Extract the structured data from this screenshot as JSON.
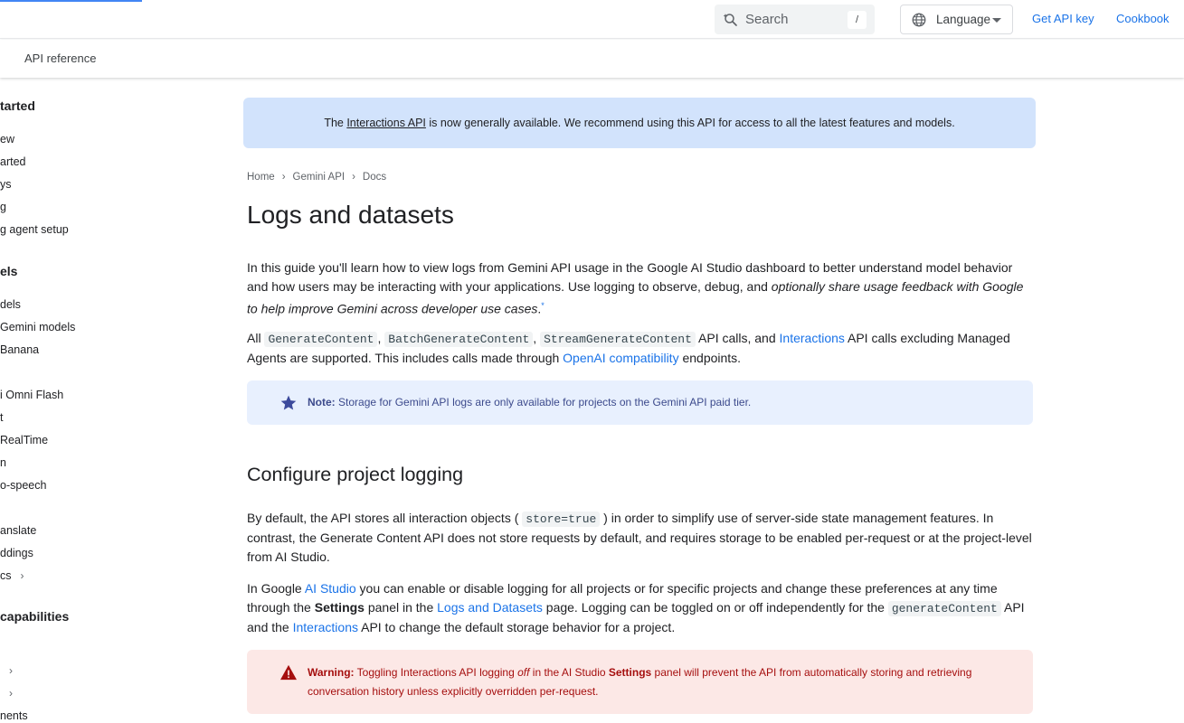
{
  "topbar": {
    "search_placeholder": "Search",
    "search_shortcut": "/",
    "language_label": "Language",
    "get_api_key": "Get API key",
    "cookbook": "Cookbook"
  },
  "subbar": {
    "api_reference": "API reference"
  },
  "sidebar": {
    "items": [
      {
        "label": "tarted",
        "heading": true
      },
      {
        "label": "ew"
      },
      {
        "label": "arted"
      },
      {
        "label": "ys"
      },
      {
        "label": "g"
      },
      {
        "label": "g agent setup"
      },
      {
        "label": "els",
        "heading": true
      },
      {
        "label": "dels"
      },
      {
        "label": " Gemini models"
      },
      {
        "label": "Banana"
      },
      {
        "label": "i Omni Flash"
      },
      {
        "label": "t"
      },
      {
        "label": "RealTime"
      },
      {
        "label": "n"
      },
      {
        "label": "o-speech"
      },
      {
        "label": "anslate"
      },
      {
        "label": "ddings"
      },
      {
        "label": "cs",
        "chevron": true
      },
      {
        "label": "capabilities",
        "heading": true
      },
      {
        "label": "",
        "chevron": true
      },
      {
        "label": "",
        "chevron": true
      },
      {
        "label": "nents"
      }
    ]
  },
  "banner": {
    "pre": "The ",
    "link": "Interactions API",
    "post": " is now generally available. We recommend using this API for access to all the latest features and models."
  },
  "breadcrumb": [
    "Home",
    "Gemini API",
    "Docs"
  ],
  "page": {
    "title": "Logs and datasets",
    "intro": {
      "text1": "In this guide you'll learn how to view logs from Gemini API usage in the Google AI Studio dashboard to better understand model behavior and how users may be interacting with your applications. Use logging to observe, debug, and ",
      "italic": "optionally share usage feedback with Google to help improve Gemini across developer use cases",
      "text2": ".",
      "sup": "*"
    },
    "supported": {
      "pre": "All ",
      "code1": "GenerateContent",
      "sep1": ", ",
      "code2": "BatchGenerateContent",
      "sep2": ", ",
      "code3": "StreamGenerateContent",
      "mid": " API calls, and ",
      "link1": "Interactions",
      "mid2": " API calls excluding Managed Agents are supported. This includes calls made through ",
      "link2": "OpenAI compatibility",
      "post": " endpoints."
    },
    "note": {
      "label": "Note:",
      "text": " Storage for Gemini API logs are only available for projects on the Gemini API paid tier."
    },
    "section_title": "Configure project logging",
    "para3": {
      "pre": "By default, the API stores all interaction objects ( ",
      "code": "store=true",
      "post": " ) in order to simplify use of server-side state management features. In contrast, the Generate Content API does not store requests by default, and requires storage to be enabled per-request or at the project-level from AI Studio."
    },
    "para4": {
      "pre": "In Google ",
      "link1": "AI Studio",
      "mid1": " you can enable or disable logging for all projects or for specific projects and change these preferences at any time through the ",
      "bold": "Settings",
      "mid2": " panel in the ",
      "link2": "Logs and Datasets",
      "mid3": " page. Logging can be toggled on or off independently for the ",
      "code": "generateContent",
      "mid4": " API and the ",
      "link3": "Interactions",
      "post": " API to change the default storage behavior for a project."
    },
    "warning": {
      "label": "Warning:",
      "text1": " Toggling Interactions API logging ",
      "italic": "off",
      "text2": " in the AI Studio ",
      "bold": "Settings",
      "text3": " panel will prevent the API from automatically storing and retrieving conversation history unless explicitly overridden per-request."
    }
  },
  "colors": {
    "accent": "#1a73e8",
    "banner_bg": "#d2e3fc",
    "note_bg": "#e8f0fe",
    "warning_bg": "#fce8e6",
    "warning_text": "#a50e0e"
  }
}
